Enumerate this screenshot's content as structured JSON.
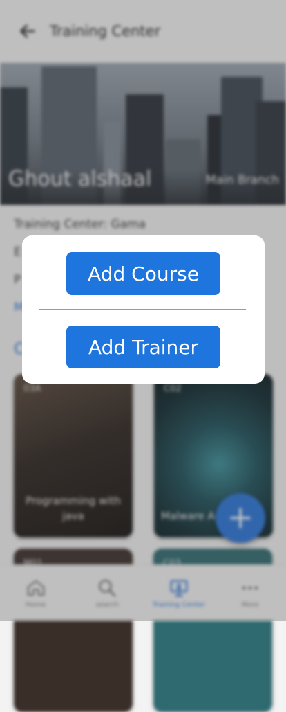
{
  "header": {
    "title": "Training Center",
    "back_icon": "arrow-left-icon"
  },
  "banner": {
    "name": "Ghout alshaal",
    "branch": "Main Branch"
  },
  "info": {
    "center_label": "Training Center: Gama",
    "row2_partial": "E",
    "row3_partial": "P",
    "more_partial": "M"
  },
  "courses": {
    "title_partial": "C",
    "cards": [
      {
        "code": "03A",
        "label": "Programming with java"
      },
      {
        "code": "C02",
        "label": "Malware Ana"
      },
      {
        "code": "M01",
        "label": ""
      },
      {
        "code": "C03",
        "label": ""
      }
    ]
  },
  "fab": {
    "icon": "plus-icon"
  },
  "nav": {
    "items": [
      {
        "label": "Home",
        "icon": "home-icon"
      },
      {
        "label": "search",
        "icon": "search-icon"
      },
      {
        "label": "Training Center",
        "icon": "presentation-icon"
      },
      {
        "label": "More",
        "icon": "more-dots-icon"
      }
    ],
    "active_color": "#2a74d8"
  },
  "modal": {
    "add_course_label": "Add Course",
    "add_trainer_label": "Add Trainer",
    "button_color": "#1f75de"
  }
}
